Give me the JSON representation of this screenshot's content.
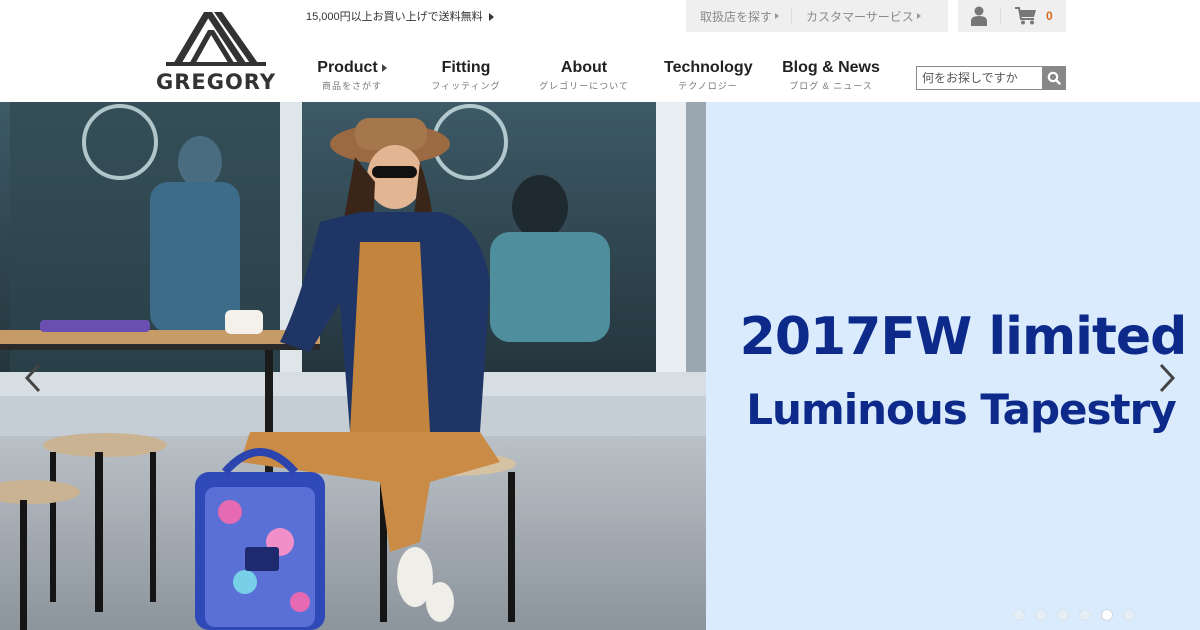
{
  "header": {
    "logo_text": "GREGORY",
    "promo_text": "15,000円以上お買い上げで送料無料",
    "util_links": [
      {
        "label": "取扱店を探す"
      },
      {
        "label": "カスタマーサービス"
      }
    ],
    "cart_count": "0",
    "search_placeholder": "何をお探しですか"
  },
  "nav": {
    "items": [
      {
        "en": "Product",
        "jp": "商品をさがす"
      },
      {
        "en": "Fitting",
        "jp": "フィッティング"
      },
      {
        "en": "About",
        "jp": "グレゴリーについて"
      },
      {
        "en": "Technology",
        "jp": "テクノロジー"
      },
      {
        "en": "Blog & News",
        "jp": "ブログ & ニュース"
      }
    ]
  },
  "hero": {
    "title_line1": "2017FW limited",
    "title_line2": "Luminous Tapestry",
    "slide_count": 6,
    "active_slide": 5
  },
  "colors": {
    "banner_bg": "#d9ebfd",
    "banner_text": "#0d2a8a",
    "cart_count": "#d2691e"
  }
}
